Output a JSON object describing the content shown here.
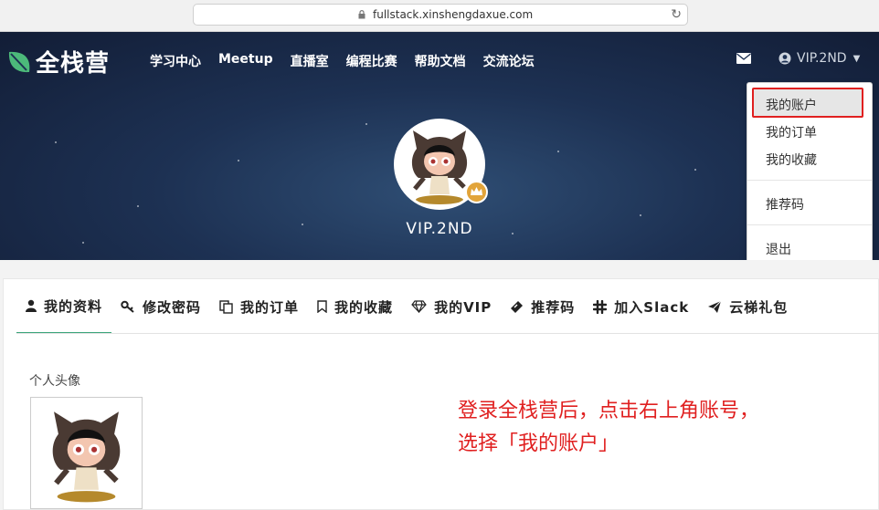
{
  "browser": {
    "url": "fullstack.xinshengdaxue.com"
  },
  "brand": {
    "name": "全栈营",
    "leaf_color": "#4cb97a"
  },
  "nav": [
    "学习中心",
    "Meetup",
    "直播室",
    "编程比赛",
    "帮助文档",
    "交流论坛"
  ],
  "user": {
    "name": "VIP.2ND"
  },
  "dropdown": {
    "items": [
      "我的账户",
      "我的订单",
      "我的收藏",
      "推荐码",
      "退出"
    ],
    "highlighted": "我的账户"
  },
  "tabs": [
    {
      "icon": "user-icon",
      "label": "我的资料",
      "active": true
    },
    {
      "icon": "key-icon",
      "label": "修改密码"
    },
    {
      "icon": "copy-icon",
      "label": "我的订单"
    },
    {
      "icon": "bookmark-icon",
      "label": "我的收藏"
    },
    {
      "icon": "diamond-icon",
      "label": "我的VIP"
    },
    {
      "icon": "ticket-icon",
      "label": "推荐码"
    },
    {
      "icon": "slack-icon",
      "label": "加入Slack"
    },
    {
      "icon": "paper-plane-icon",
      "label": "云梯礼包"
    }
  ],
  "profile": {
    "avatar_label": "个人头像"
  },
  "annotation": {
    "line1": "登录全栈营后，点击右上角账号，",
    "line2": "选择「我的账户」",
    "color": "#e02020"
  }
}
